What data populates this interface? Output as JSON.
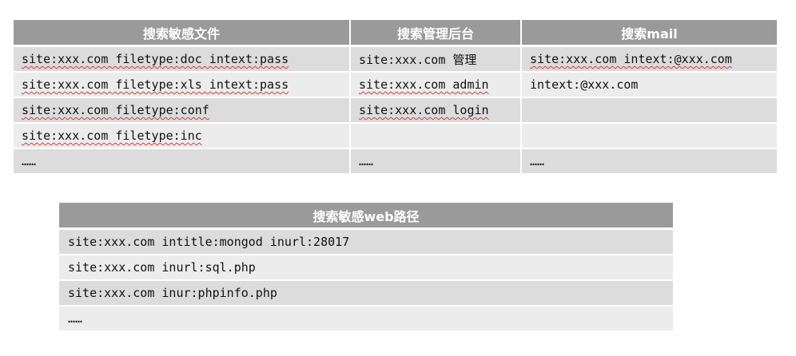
{
  "table_files": {
    "headers": [
      "搜索敏感文件",
      "搜索管理后台",
      "搜索mail"
    ],
    "rows": [
      [
        "site:xxx.com filetype:doc intext:pass",
        "site:xxx.com 管理",
        "site:xxx.com intext:@xxx.com"
      ],
      [
        "site:xxx.com filetype:xls intext:pass",
        "site:xxx.com admin",
        "intext:@xxx.com"
      ],
      [
        "site:xxx.com filetype:conf",
        "site:xxx.com login",
        ""
      ],
      [
        "site:xxx.com filetype:inc",
        "",
        ""
      ],
      [
        "……",
        "……",
        "……"
      ]
    ]
  },
  "table_web": {
    "header": "搜索敏感web路径",
    "rows": [
      "site:xxx.com intitle:mongod inurl:28017",
      "site:xxx.com inurl:sql.php",
      "site:xxx.com inur:phpinfo.php",
      "……"
    ]
  }
}
